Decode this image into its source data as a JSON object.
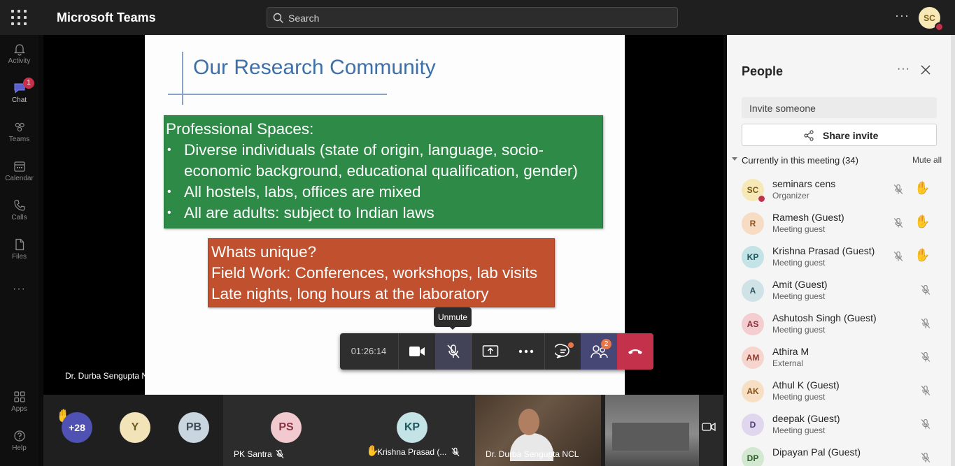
{
  "app": {
    "title": "Microsoft Teams"
  },
  "search": {
    "placeholder": "Search"
  },
  "user": {
    "initials": "SC"
  },
  "rail": {
    "items": [
      {
        "label": "Activity",
        "icon": "bell-icon"
      },
      {
        "label": "Chat",
        "icon": "chat-icon",
        "badge": "1"
      },
      {
        "label": "Teams",
        "icon": "teams-icon"
      },
      {
        "label": "Calendar",
        "icon": "calendar-icon"
      },
      {
        "label": "Calls",
        "icon": "phone-icon"
      },
      {
        "label": "Files",
        "icon": "file-icon"
      }
    ],
    "more": "···",
    "apps": "Apps",
    "help": "Help"
  },
  "slide": {
    "title": "Our Research Community",
    "green_heading": "Professional Spaces:",
    "green_lines": [
      "Diverse individuals (state of origin, language, socio-",
      "economic background, educational qualification, gender)",
      "All hostels, labs, offices are mixed",
      "All are adults: subject to Indian laws"
    ],
    "bullet": "•",
    "red_lines": [
      "Whats unique?",
      "Field Work: Conferences, workshops, lab visits",
      "Late nights, long hours at the laboratory"
    ]
  },
  "stage": {
    "presenter": "Dr. Durba Sengupta NCL"
  },
  "controls": {
    "timer": "01:26:14",
    "tooltip": "Unmute",
    "people_badge": "2"
  },
  "gallery": {
    "overflow": "+28",
    "tiles": [
      {
        "initials": "Y",
        "color": "#f2e4b8",
        "text": "#6e5a1e"
      },
      {
        "initials": "PB",
        "color": "#c9d6df",
        "text": "#3c4b55"
      },
      {
        "initials": "PS",
        "color": "#f2c9cf",
        "text": "#8a3344",
        "name": "PK Santra"
      },
      {
        "initials": "KP",
        "color": "#c3e3e6",
        "text": "#20585f",
        "name": "Krishna Prasad (..."
      },
      {
        "name": "Dr. Durba Sengupta NCL"
      }
    ]
  },
  "panel": {
    "title": "People",
    "invite_placeholder": "Invite someone",
    "share_label": "Share invite",
    "section": "Currently in this meeting (34)",
    "mute_all": "Mute all",
    "participants": [
      {
        "initials": "SC",
        "name": "seminars cens",
        "role": "Organizer",
        "color": "#f6e8b7",
        "text": "#7a5c15",
        "hand": true
      },
      {
        "initials": "R",
        "name": "Ramesh (Guest)",
        "role": "Meeting guest",
        "color": "#f7dcc4",
        "text": "#8a4d1c",
        "hand": true
      },
      {
        "initials": "KP",
        "name": "Krishna Prasad (Guest)",
        "role": "Meeting guest",
        "color": "#c3e3e6",
        "text": "#20585f",
        "hand": true
      },
      {
        "initials": "A",
        "name": "Amit (Guest)",
        "role": "Meeting guest",
        "color": "#cfe2e6",
        "text": "#2d5560",
        "hand": false
      },
      {
        "initials": "AS",
        "name": "Ashutosh Singh (Guest)",
        "role": "Meeting guest",
        "color": "#f3cdd0",
        "text": "#8a2e3a",
        "hand": false
      },
      {
        "initials": "AM",
        "name": "Athira M",
        "role": "External",
        "color": "#f6d5cf",
        "text": "#8e3b2b",
        "hand": false
      },
      {
        "initials": "AK",
        "name": "Athul K (Guest)",
        "role": "Meeting guest",
        "color": "#f6dfc2",
        "text": "#85531b",
        "hand": false
      },
      {
        "initials": "D",
        "name": "deepak (Guest)",
        "role": "Meeting guest",
        "color": "#e0d6ee",
        "text": "#4e3a7a",
        "hand": false
      },
      {
        "initials": "DP",
        "name": "Dipayan Pal (Guest)",
        "role": "",
        "color": "#d2e8d0",
        "text": "#2f5e2b",
        "hand": false
      }
    ]
  }
}
